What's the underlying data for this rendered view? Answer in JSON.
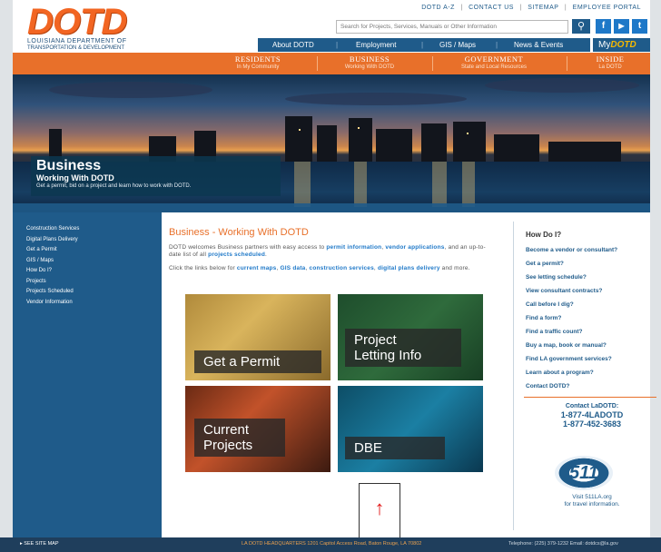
{
  "header": {
    "logo_text": "DOTD",
    "logo_sub1": "LOUISIANA DEPARTMENT OF",
    "logo_sub2": "TRANSPORTATION & DEVELOPMENT",
    "top_links": [
      "DOTD A-Z",
      "CONTACT US",
      "SITEMAP",
      "EMPLOYEE PORTAL"
    ],
    "search_placeholder": "Search for Projects, Services, Manuals or Other Information",
    "social": [
      "f",
      "▶",
      "t"
    ],
    "nav": [
      "About DOTD",
      "Employment",
      "GIS / Maps",
      "News & Events"
    ],
    "mydotd_prefix": "My",
    "mydotd_brand": "DOTD"
  },
  "categories": [
    {
      "title": "RESIDENTS",
      "sub": "In My Community"
    },
    {
      "title": "BUSINESS",
      "sub": "Working With DOTD"
    },
    {
      "title": "GOVERNMENT",
      "sub": "State and Local Resources"
    },
    {
      "title": "INSIDE",
      "sub": "La DOTD"
    }
  ],
  "hero": {
    "title": "Business",
    "subtitle": "Working With DOTD",
    "tagline": "Get a permit, bid on a project and learn how to work with DOTD."
  },
  "sidebar": {
    "links": [
      "Construction Services",
      "Digital Plans Delivery",
      "Get a Permit",
      "GIS / Maps",
      "How Do I?",
      "Projects",
      "Projects Scheduled",
      "Vendor Information"
    ]
  },
  "main": {
    "title": "Business - Working With DOTD",
    "p1_a": "DOTD welcomes Business partners with easy access to ",
    "p1_link1": "permit information",
    "p1_b": ", ",
    "p1_link2": "vendor applications",
    "p1_c": ", and an up-to-date list of all ",
    "p1_link3": "projects scheduled",
    "p1_d": ".",
    "p2_a": "Click the links below for ",
    "p2_link1": "current maps",
    "p2_b": ", ",
    "p2_link2": "GIS data",
    "p2_c": ", ",
    "p2_link3": "construction services",
    "p2_d": ", ",
    "p2_link4": "digital plans delivery",
    "p2_e": " and more.",
    "tiles": {
      "permit": "Get a Permit",
      "letting_1": "Project",
      "letting_2": "Letting Info",
      "current_1": "Current",
      "current_2": "Projects",
      "dbe": "DBE"
    },
    "arrow": "↑"
  },
  "right": {
    "heading": "How Do I?",
    "links": [
      "Become a vendor or consultant?",
      "Get a permit?",
      "See letting schedule?",
      "View consultant contracts?",
      "Call before I dig?",
      "Find a form?",
      "Find a traffic count?",
      "Buy a map, book or manual?",
      "Find LA government services?",
      "Learn about a program?",
      "Contact DOTD?"
    ],
    "contact_label": "Contact LaDOTD:",
    "phone1": "1-877-4LADOTD",
    "phone2": "1-877-452-3683",
    "badge": "511",
    "visit_1": "Visit 511LA.org",
    "visit_2": "for travel information."
  },
  "footer": {
    "sitemap": "▸ SEE SITE MAP",
    "hq": "LA DOTD HEADQUARTERS 1201 Capitol Access Road, Baton Rouge, LA 70802",
    "contact": "Telephone: (225) 379-1232   Email: dotdcs@la.gov"
  }
}
